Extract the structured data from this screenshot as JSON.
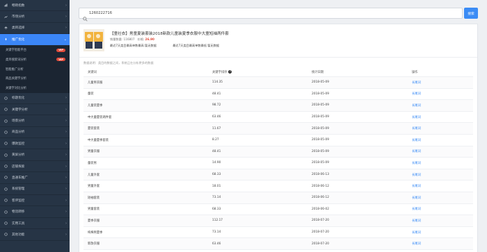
{
  "sidebar": {
    "items_top": [
      {
        "label": "畅销指数",
        "icon": "chart-icon"
      },
      {
        "label": "市场分析",
        "icon": "line-chart-icon"
      },
      {
        "label": "类目选择",
        "icon": "layers-icon"
      }
    ],
    "active": {
      "label": "推广优化",
      "icon": "rocket-icon"
    },
    "sub_items": [
      {
        "label": "关键字智能平台",
        "vip": "VIP"
      },
      {
        "label": "类目搜索词分析",
        "vip": "VIP"
      },
      {
        "label": "智能推广分析",
        "vip": ""
      },
      {
        "label": "商品关键字分析",
        "vip": ""
      },
      {
        "label": "关键字对比分析",
        "vip": ""
      }
    ],
    "items_bottom": [
      {
        "label": "标题优化",
        "icon": "tag-icon"
      },
      {
        "label": "关键字分析",
        "icon": "key-icon"
      },
      {
        "label": "场景分析",
        "icon": "scene-icon"
      },
      {
        "label": "商品分析",
        "icon": "box-icon"
      },
      {
        "label": "爆款监控",
        "icon": "fire-icon"
      },
      {
        "label": "黄屏分析",
        "icon": "monitor-icon"
      },
      {
        "label": "店铺探索",
        "icon": "shop-icon"
      },
      {
        "label": "直通车推广",
        "icon": "car-icon"
      },
      {
        "label": "系统管理",
        "icon": "gear-icon"
      },
      {
        "label": "客评监控",
        "icon": "comment-icon"
      },
      {
        "label": "物流转移",
        "icon": "truck-icon"
      },
      {
        "label": "实用工具",
        "icon": "tool-icon"
      },
      {
        "label": "其他功能",
        "icon": "more-icon"
      }
    ],
    "chevron": "›"
  },
  "search": {
    "value": "1260222716",
    "button": "搜索"
  },
  "product": {
    "title": "【童社衣】男童夏装套装2018新款儿童装夏季衣服中大童短袖两件套",
    "sales_label": "销量数量:",
    "sales_value": "116807",
    "price_label": "价格:",
    "price_value": "26.90",
    "rank1": "最近7天类目最高单数最高:暂无数据",
    "rank2": "最近7天类目最高单数最低:暂无数据"
  },
  "notice": "数据说明：类目的数据之间，系统正在分析更多的数据",
  "table": {
    "headers": [
      "关键词",
      "关键字排序",
      "统计日期",
      "操作"
    ],
    "action_label": "长尾词",
    "rows": [
      {
        "kw": "儿童男衣服",
        "v": "114.35",
        "d": "2018-05-09"
      },
      {
        "kw": "童装",
        "v": "48.41",
        "d": "2018-05-09"
      },
      {
        "kw": "儿童装夏季",
        "v": "98.72",
        "d": "2018-05-09"
      },
      {
        "kw": "中大童夏装两件套",
        "v": "63.46",
        "d": "2018-05-09"
      },
      {
        "kw": "夏装套装",
        "v": "11.67",
        "d": "2018-05-09"
      },
      {
        "kw": "中大童夏季套装",
        "v": "8.27",
        "d": "2018-05-09"
      },
      {
        "kw": "男童衣服",
        "v": "48.41",
        "d": "2018-05-09"
      },
      {
        "kw": "童装男",
        "v": "14.90",
        "d": "2018-05-09"
      },
      {
        "kw": "儿童外套",
        "v": "68.33",
        "d": "2018-06-13"
      },
      {
        "kw": "男童外套",
        "v": "18.01",
        "d": "2018-06-12"
      },
      {
        "kw": "短袖套装",
        "v": "73.14",
        "d": "2018-06-12"
      },
      {
        "kw": "男童套装",
        "v": "68.33",
        "d": "2018-06-02"
      },
      {
        "kw": "夏季衣服",
        "v": "112.17",
        "d": "2018-07-20"
      },
      {
        "kw": "纯棉男夏季",
        "v": "73.14",
        "d": "2018-07-20"
      },
      {
        "kw": "新款衣服",
        "v": "63.46",
        "d": "2018-07-20"
      }
    ]
  }
}
